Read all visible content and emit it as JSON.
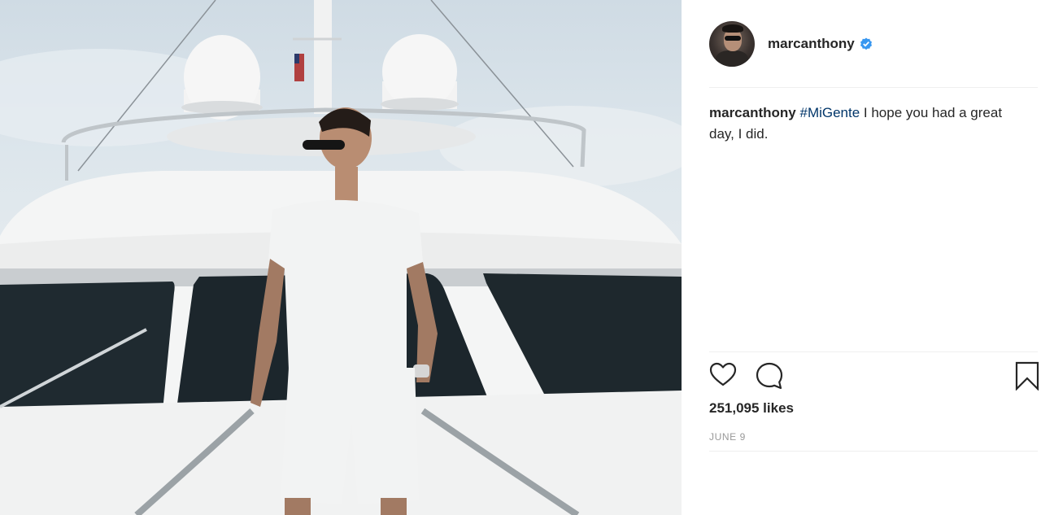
{
  "post": {
    "username": "marcanthony",
    "caption": {
      "username": "marcanthony",
      "hashtag": "#MiGente",
      "text": " I hope you had a great day, I did."
    },
    "likes": "251,095 likes",
    "date": "JUNE 9"
  },
  "icons": {
    "verified": "verified-badge-icon",
    "like": "heart-icon",
    "comment": "comment-bubble-icon",
    "save": "bookmark-icon"
  },
  "colors": {
    "verified": "#3897f0",
    "hashtag": "#003569",
    "muted": "#999999",
    "text": "#262626"
  }
}
